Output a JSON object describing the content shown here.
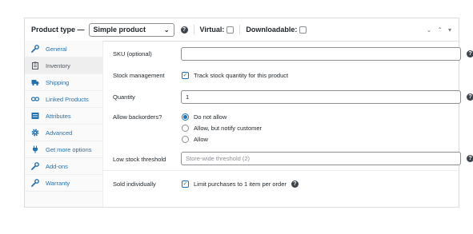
{
  "header": {
    "product_type_label": "Product type —",
    "product_type_value": "Simple product",
    "virtual_label": "Virtual:",
    "virtual_checked": false,
    "downloadable_label": "Downloadable:",
    "downloadable_checked": false
  },
  "sidebar": {
    "items": [
      {
        "label": "General",
        "icon": "wrench-icon",
        "active": false
      },
      {
        "label": "Inventory",
        "icon": "clipboard-icon",
        "active": true
      },
      {
        "label": "Shipping",
        "icon": "truck-icon",
        "active": false
      },
      {
        "label": "Linked Products",
        "icon": "link-icon",
        "active": false
      },
      {
        "label": "Attributes",
        "icon": "list-icon",
        "active": false
      },
      {
        "label": "Advanced",
        "icon": "gear-icon",
        "active": false
      },
      {
        "label": "Get more options",
        "icon": "plug-icon",
        "active": false
      },
      {
        "label": "Add-ons",
        "icon": "wrench-icon",
        "active": false
      },
      {
        "label": "Warranty",
        "icon": "wrench-icon",
        "active": false
      }
    ]
  },
  "inventory": {
    "sku_label": "SKU (optional)",
    "sku_value": "",
    "stock_management_label": "Stock management",
    "track_stock_label": "Track stock quantity for this product",
    "track_stock_checked": true,
    "quantity_label": "Quantity",
    "quantity_value": "1",
    "backorders_label": "Allow backorders?",
    "backorder_options": [
      "Do not allow",
      "Allow, but notify customer",
      "Allow"
    ],
    "backorder_selected": "Do not allow",
    "low_stock_label": "Low stock threshold",
    "low_stock_placeholder": "Store-wide threshold (2)",
    "sold_individually_label": "Sold individually",
    "limit_purchases_label": "Limit purchases to 1 item per order",
    "limit_purchases_checked": true
  },
  "colors": {
    "accent": "#2271b1",
    "border": "#dcdcde",
    "sidebar_bg": "#fafafa",
    "active_tab_bg": "#eeeeee"
  }
}
